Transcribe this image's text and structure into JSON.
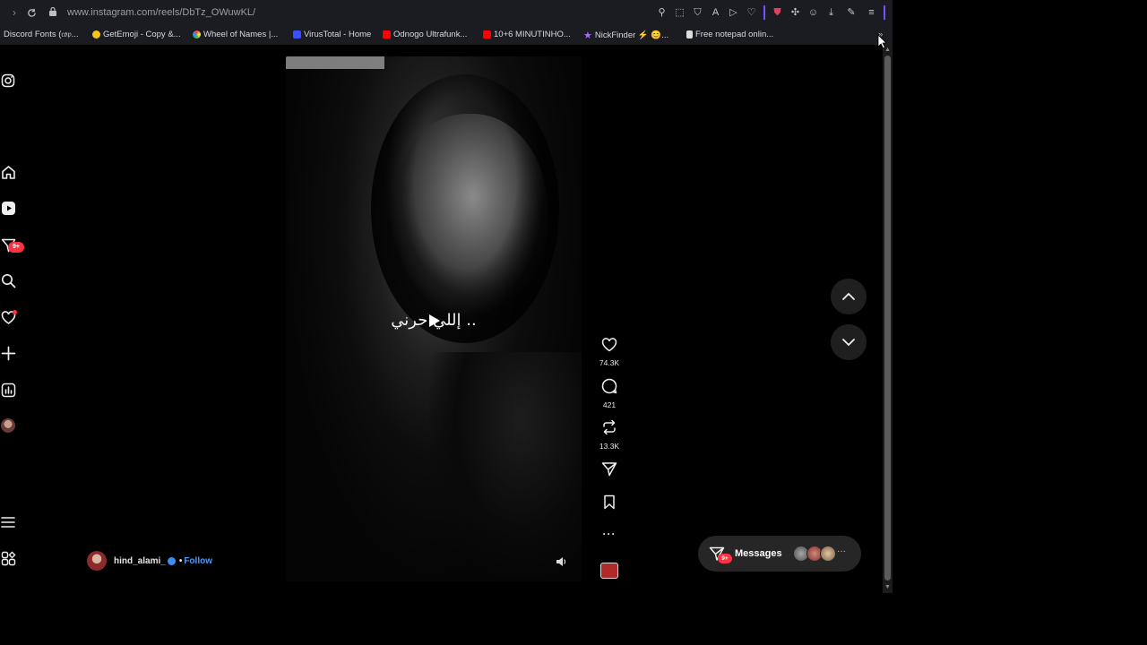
{
  "browser": {
    "url": "www.instagram.com/reels/DbTz_OWuwKL/",
    "bookmarks": [
      {
        "label": "Discord Fonts (𝔠𝔬𝔭...",
        "color": "#5865f2"
      },
      {
        "label": "GetEmoji - Copy &...",
        "color": "#f5c518"
      },
      {
        "label": "Wheel of Names |...",
        "color": "#4caf50"
      },
      {
        "label": "VirusTotal - Home",
        "color": "#394eff"
      },
      {
        "label": "Odnogo Ultrafunk...",
        "color": "#ff0000"
      },
      {
        "label": "10+6 MINUTINHO...",
        "color": "#ff0000"
      },
      {
        "label": "NickFinder ⚡ 😊...",
        "color": "#a26bff"
      },
      {
        "label": "Free notepad onlin...",
        "color": "#dddddd"
      }
    ]
  },
  "reel": {
    "caption": "إللي حرني ..",
    "author": "hind_alami_",
    "follow_label": "Follow",
    "separator": "•",
    "likes": "74.3K",
    "comments": "421",
    "reposts": "13.3K",
    "more_label": "···"
  },
  "sidebar": {
    "messages_badge": "9+"
  },
  "messages": {
    "label": "Messages",
    "badge": "9+",
    "more": "···"
  },
  "colors": {
    "accent_blue": "#4e9bf5",
    "notification_red": "#ff3040",
    "extension_purple": "#7b4dff"
  }
}
